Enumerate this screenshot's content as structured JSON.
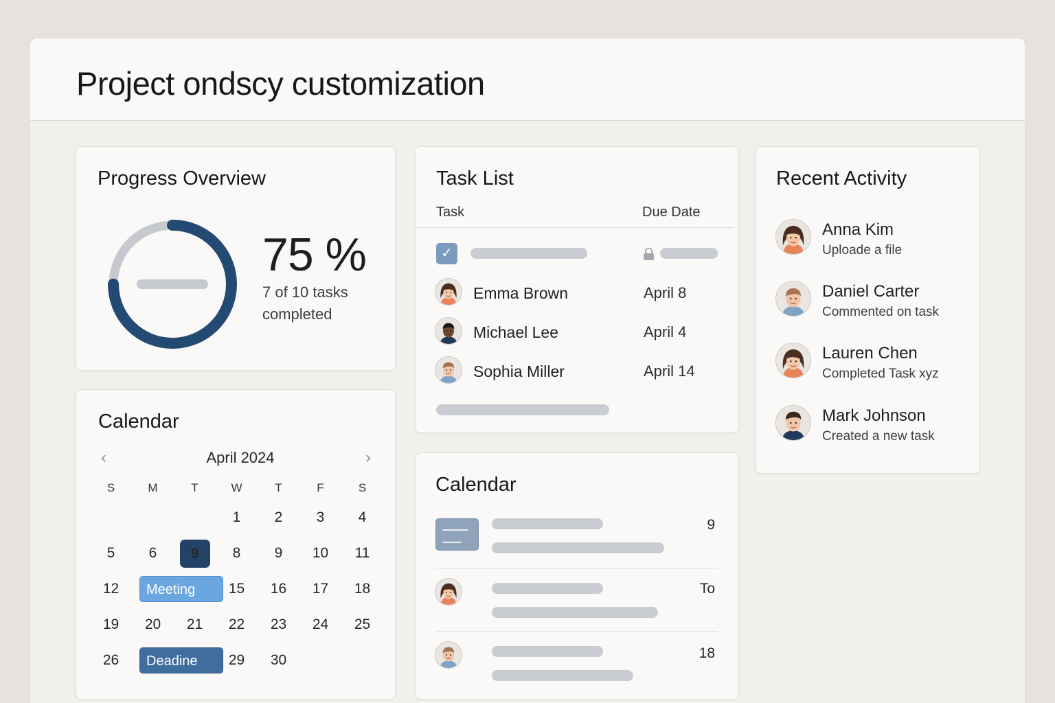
{
  "page_title": "Project ondscy customization",
  "progress": {
    "title": "Progress Overview",
    "percent_label": "75 %",
    "percent_value": 75,
    "subtitle": "7 of 10 tasks completed",
    "colors": {
      "fill": "#234a72",
      "track": "#c6c9ce"
    }
  },
  "calendar": {
    "title": "Calendar",
    "month_label": "April 2024",
    "prev_icon": "chevron-left-icon",
    "next_icon": "chevron-right-icon",
    "weekdays": [
      "S",
      "M",
      "T",
      "W",
      "T",
      "F",
      "S"
    ],
    "selected_day": "9",
    "days": {
      "d1": "1",
      "d2": "2",
      "d3": "3",
      "d4": "4",
      "d5": "5",
      "d6": "6",
      "d9": "9",
      "d8": "8",
      "d9b": "9",
      "d10": "10",
      "d11": "11",
      "d12": "12",
      "d15": "15",
      "d16": "16",
      "d17": "17",
      "d18": "18",
      "d19": "19",
      "d20": "20",
      "d21": "21",
      "d22": "22",
      "d23": "23",
      "d24": "24",
      "d25": "25",
      "d26": "26",
      "d29": "29",
      "d30": "30"
    },
    "events": {
      "meeting": "Meeting",
      "deadline": "Deadine"
    },
    "colors": {
      "selected": "#234266",
      "meeting": "#6aa6e0",
      "deadline": "#3f6d9d"
    }
  },
  "task_list": {
    "title": "Task List",
    "headers": {
      "task": "Task",
      "due": "Due Date"
    },
    "rows": [
      {
        "name": "Emma Brown",
        "due": "April 8"
      },
      {
        "name": "Michael Lee",
        "due": "April 4"
      },
      {
        "name": "Sophia Miller",
        "due": "April 14"
      }
    ]
  },
  "calendar2": {
    "title": "Calendar",
    "items": [
      {
        "value": "9"
      },
      {
        "value": "To"
      },
      {
        "value": "18"
      }
    ]
  },
  "activity": {
    "title": "Recent Activity",
    "items": [
      {
        "name": "Anna Kim",
        "desc": "Uploade a file"
      },
      {
        "name": "Daniel Carter",
        "desc": "Commented on task"
      },
      {
        "name": "Lauren Chen",
        "desc": "Completed Task xyz"
      },
      {
        "name": "Mark Johnson",
        "desc": "Created a new task"
      }
    ]
  }
}
